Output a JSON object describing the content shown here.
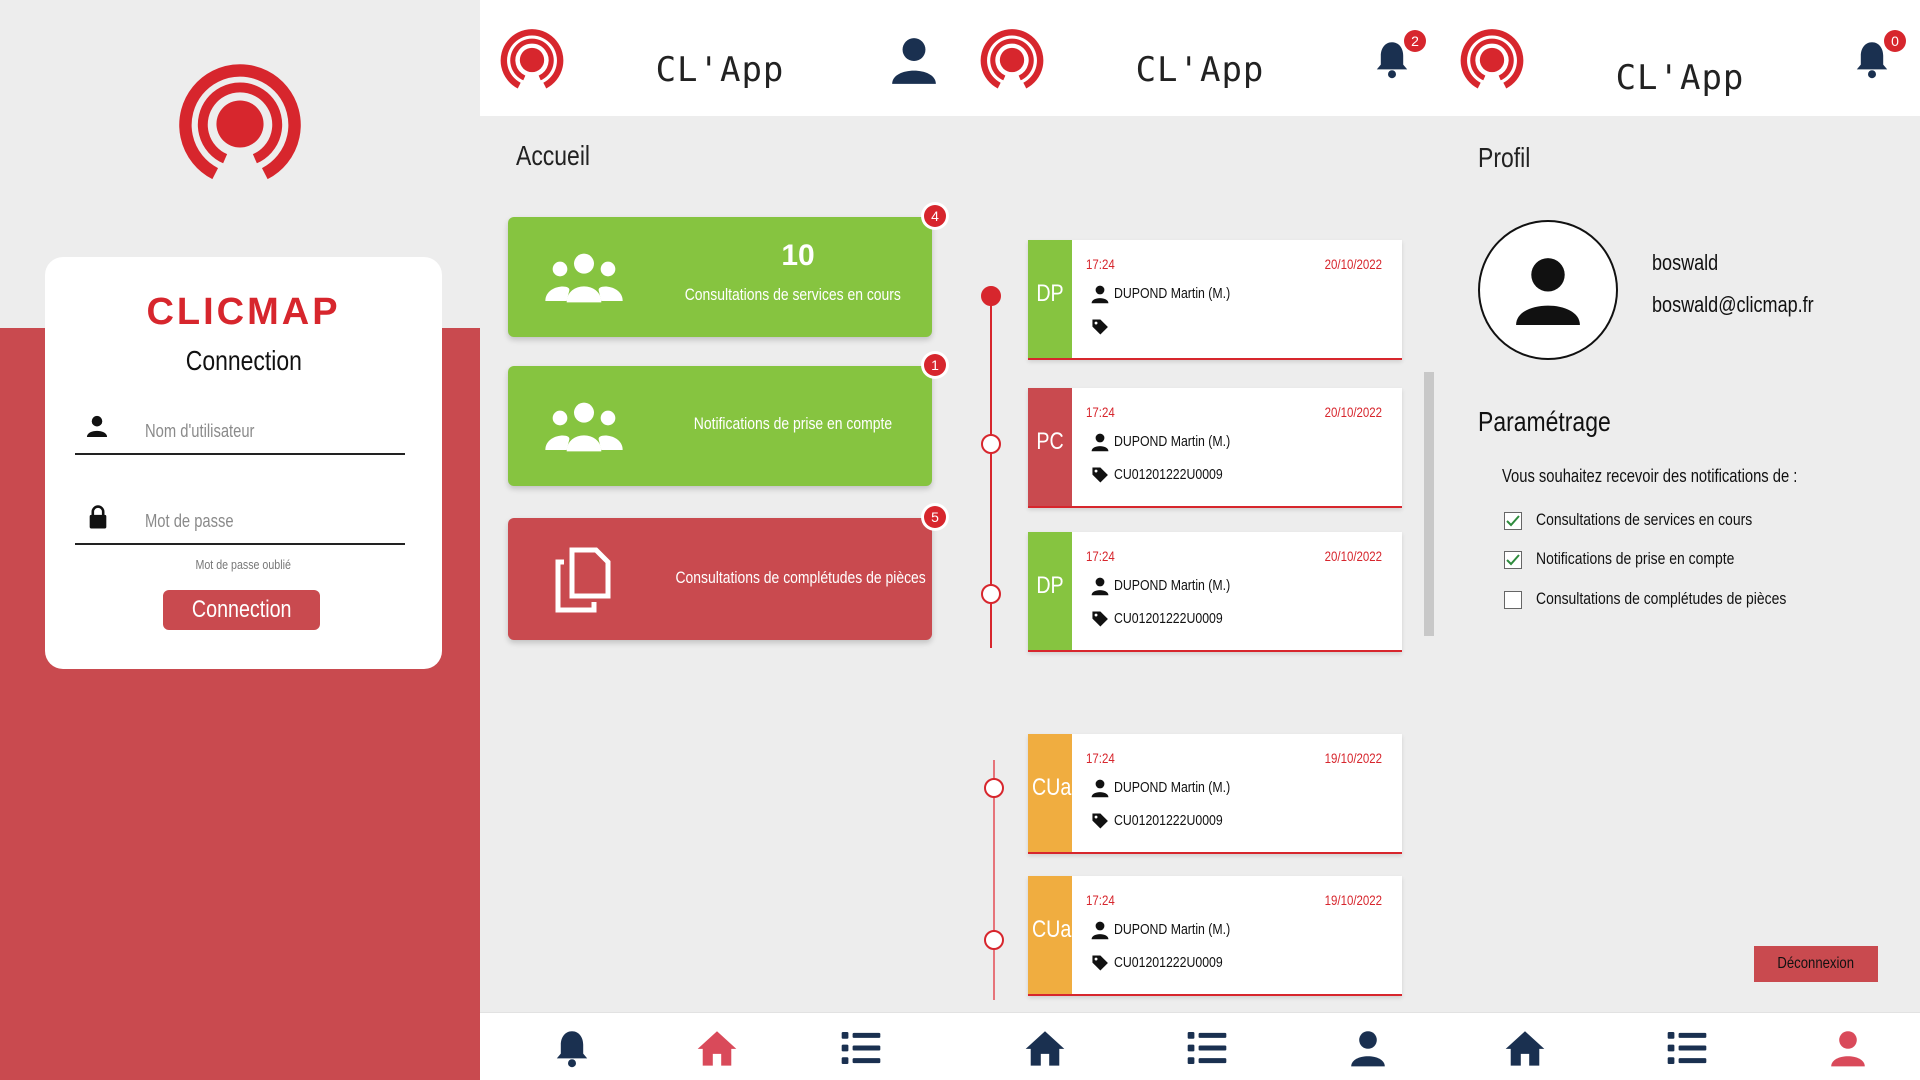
{
  "colors": {
    "red": "#c94a4f",
    "brand_red": "#d7262d",
    "green": "#86c440",
    "orange": "#f0ad40",
    "navy": "#1a3050",
    "pink": "#d94a5a"
  },
  "login": {
    "brand": "CLICMAP",
    "title": "Connection",
    "username_placeholder": "Nom d'utilisateur",
    "password_placeholder": "Mot de passe",
    "forgot": "Mot de passe oublié",
    "button": "Connection"
  },
  "header": {
    "app_title": "CL'App"
  },
  "home": {
    "title": "Accueil",
    "tiles": [
      {
        "count": "10",
        "label": "Consultations de services en cours",
        "badge": "4"
      },
      {
        "label": "Notifications de prise en compte",
        "badge": "1"
      },
      {
        "label": "Consultations de complétudes de pièces",
        "badge": "5"
      }
    ]
  },
  "notifications": {
    "bell_badge": "2",
    "cards": [
      {
        "tag": "DP",
        "time": "17:24",
        "date": "20/10/2022",
        "person": "DUPOND Martin (M.)",
        "ref": ""
      },
      {
        "tag": "PC",
        "time": "17:24",
        "date": "20/10/2022",
        "person": "DUPOND Martin (M.)",
        "ref": "CU01201222U0009"
      },
      {
        "tag": "DP",
        "time": "17:24",
        "date": "20/10/2022",
        "person": "DUPOND Martin (M.)",
        "ref": "CU01201222U0009"
      },
      {
        "tag": "CUa",
        "time": "17:24",
        "date": "19/10/2022",
        "person": "DUPOND Martin (M.)",
        "ref": "CU01201222U0009"
      },
      {
        "tag": "CUa",
        "time": "17:24",
        "date": "19/10/2022",
        "person": "DUPOND Martin (M.)",
        "ref": "CU01201222U0009"
      }
    ]
  },
  "profile": {
    "bell_badge": "0",
    "title": "Profil",
    "username": "boswald",
    "email": "boswald@clicmap.fr",
    "settings_title": "Paramétrage",
    "question": "Vous souhaitez recevoir des notifications de :",
    "options": [
      {
        "label": "Consultations de services en cours",
        "checked": true
      },
      {
        "label": "Notifications de prise en compte",
        "checked": true
      },
      {
        "label": "Consultations de complétudes de pièces",
        "checked": false
      }
    ],
    "logout": "Déconnexion"
  }
}
